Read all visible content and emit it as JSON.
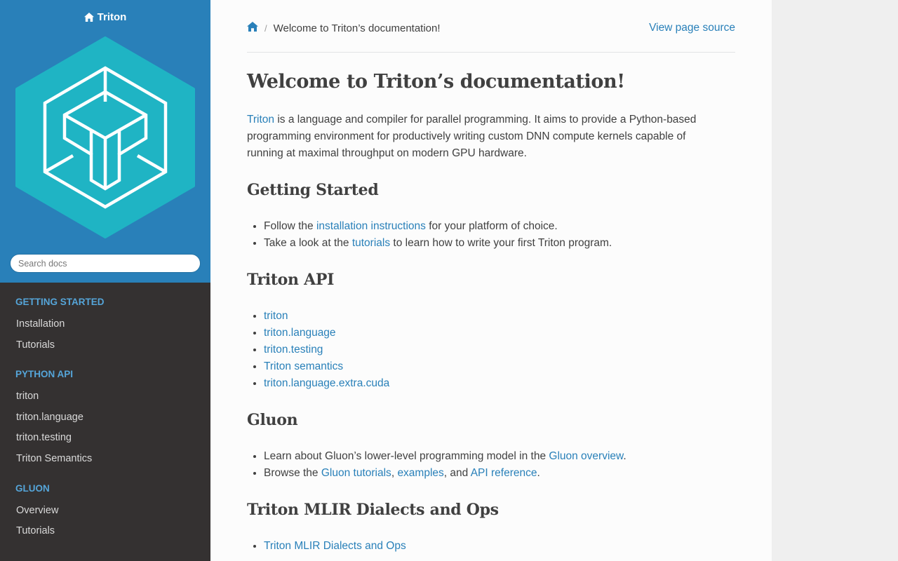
{
  "sidebar": {
    "brand": "Triton",
    "search_placeholder": "Search docs",
    "sections": [
      {
        "caption": "GETTING STARTED",
        "items": [
          "Installation",
          "Tutorials"
        ]
      },
      {
        "caption": "PYTHON API",
        "items": [
          "triton",
          "triton.language",
          "triton.testing",
          "Triton Semantics"
        ]
      },
      {
        "caption": "GLUON",
        "items": [
          "Overview",
          "Tutorials"
        ]
      }
    ]
  },
  "breadcrumbs": {
    "home_icon": "home-icon",
    "separator": "/",
    "current": "Welcome to Triton’s documentation!",
    "view_source": "View page source"
  },
  "content": {
    "title": "Welcome to Triton’s documentation!",
    "intro": {
      "link": "Triton",
      "line1": " is a language and compiler for parallel programming. It aims to provide a Python-based",
      "line2": "programming environment for productively writing custom DNN compute kernels capable of",
      "line3": "running at maximal throughput on modern GPU hardware."
    },
    "getting_started": {
      "heading": "Getting Started",
      "items": [
        {
          "pre": "Follow the ",
          "link": "installation instructions",
          "post": " for your platform of choice."
        },
        {
          "pre": "Take a look at the ",
          "link": "tutorials",
          "post": " to learn how to write your first Triton program."
        }
      ]
    },
    "triton_api": {
      "heading": "Triton API",
      "items": [
        "triton",
        "triton.language",
        "triton.testing",
        "Triton semantics",
        "triton.language.extra.cuda"
      ]
    },
    "gluon": {
      "heading": "Gluon",
      "item1": {
        "pre": "Learn about Gluon’s lower-level programming model in the ",
        "link": "Gluon overview",
        "post": "."
      },
      "item2": {
        "pre": "Browse the ",
        "link1": "Gluon tutorials",
        "mid1": ", ",
        "link2": "examples",
        "mid2": ", and ",
        "link3": "API reference",
        "post": "."
      }
    },
    "mlir": {
      "heading": "Triton MLIR Dialects and Ops",
      "items": [
        "Triton MLIR Dialects and Ops"
      ]
    }
  },
  "colors": {
    "sidebar_top": "#2980b9",
    "sidebar_bg": "#343131",
    "logo_hex": "#1fb4c4",
    "caption": "#55a5d9",
    "link": "#2980b9",
    "text": "#404040"
  }
}
